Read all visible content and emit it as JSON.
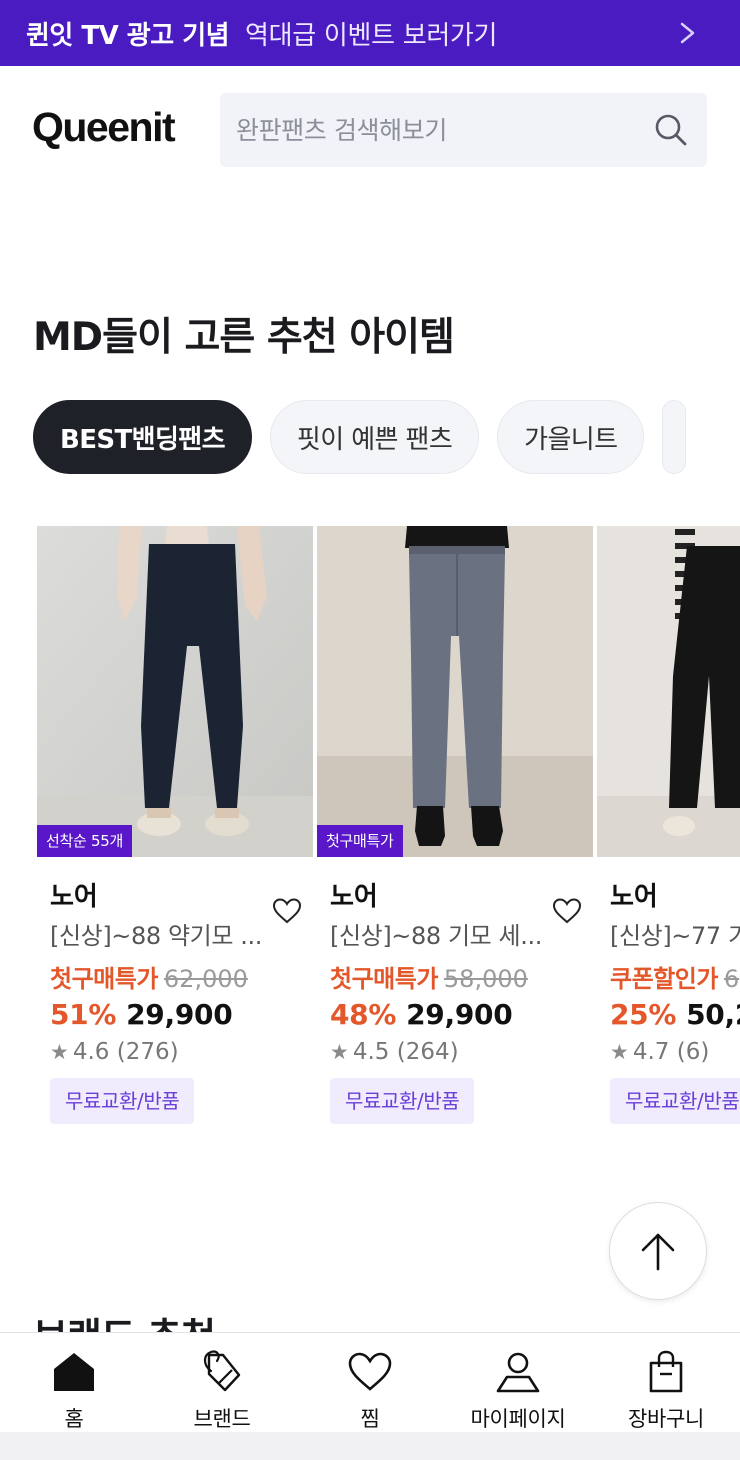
{
  "banner": {
    "strong": "퀸잇 TV 광고 기념",
    "normal": "역대급 이벤트 보러가기",
    "icon": "chevron-right-icon"
  },
  "header": {
    "logo": "Queenit",
    "search_placeholder": "완판팬츠 검색해보기",
    "search_icon": "search-icon"
  },
  "section": {
    "title": "MD들이 고른 추천 아이템",
    "chips": [
      {
        "label": "BEST밴딩팬츠",
        "active": true
      },
      {
        "label": "핏이 예쁜 팬츠",
        "active": false
      },
      {
        "label": "가을니트",
        "active": false
      }
    ]
  },
  "products": [
    {
      "badge": "선착순 55개",
      "brand": "노어",
      "name": "[신상]~88 약기모 ...",
      "promo_label": "첫구매특가",
      "original_price": "62,000",
      "discount": "51%",
      "price": "29,900",
      "rating_value": "4.6",
      "rating_count": "(276)",
      "tag": "무료교환/반품"
    },
    {
      "badge": "첫구매특가",
      "brand": "노어",
      "name": "[신상]~88 기모 세...",
      "promo_label": "첫구매특가",
      "original_price": "58,000",
      "discount": "48%",
      "price": "29,900",
      "rating_value": "4.5",
      "rating_count": "(264)",
      "tag": "무료교환/반품"
    },
    {
      "badge": "",
      "brand": "노어",
      "name": "[신상]~77 기",
      "promo_label": "쿠폰할인가",
      "original_price": "6",
      "discount": "25%",
      "price": "50,2",
      "rating_value": "4.7",
      "rating_count": "(6)",
      "tag": "무료교환/반품"
    }
  ],
  "next_section": {
    "title": "브랜드 추천"
  },
  "bottom_nav": [
    {
      "label": "홈",
      "icon": "home-icon"
    },
    {
      "label": "브랜드",
      "icon": "tag-icon"
    },
    {
      "label": "찜",
      "icon": "heart-icon"
    },
    {
      "label": "마이페이지",
      "icon": "user-icon"
    },
    {
      "label": "장바구니",
      "icon": "shopping-bag-icon"
    }
  ],
  "colors": {
    "banner_bg": "#4a1bc1",
    "accent_purple": "#5a17c9",
    "discount_orange": "#e4572a",
    "chip_active_bg": "#1f2128",
    "tag_bg": "#f1ebfe"
  }
}
